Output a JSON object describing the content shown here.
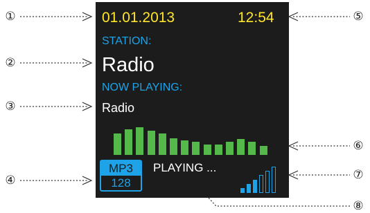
{
  "screen": {
    "date": "01.01.2013",
    "time": "12:54",
    "station_label": "STATION:",
    "station_value": "Radio",
    "now_playing_label": "NOW PLAYING:",
    "now_playing_value": "Radio",
    "status": "PLAYING ...",
    "format": "MP3",
    "bitrate": "128"
  },
  "equalizer": {
    "levels": [
      0.58,
      0.69,
      0.74,
      0.65,
      0.58,
      0.45,
      0.38,
      0.36,
      0.27,
      0.27,
      0.36,
      0.42,
      0.36,
      0.24
    ],
    "color": "#55b84a"
  },
  "signal": {
    "filled_bars": 3,
    "total_bars": 6,
    "color": "#1ea3e8"
  },
  "callouts": [
    "①",
    "②",
    "③",
    "④",
    "⑤",
    "⑥",
    "⑦",
    "⑧"
  ],
  "colors": {
    "background": "#1c1c1c",
    "date_time": "#ffe62b",
    "labels": "#1ea3e8",
    "values": "#ffffff"
  }
}
